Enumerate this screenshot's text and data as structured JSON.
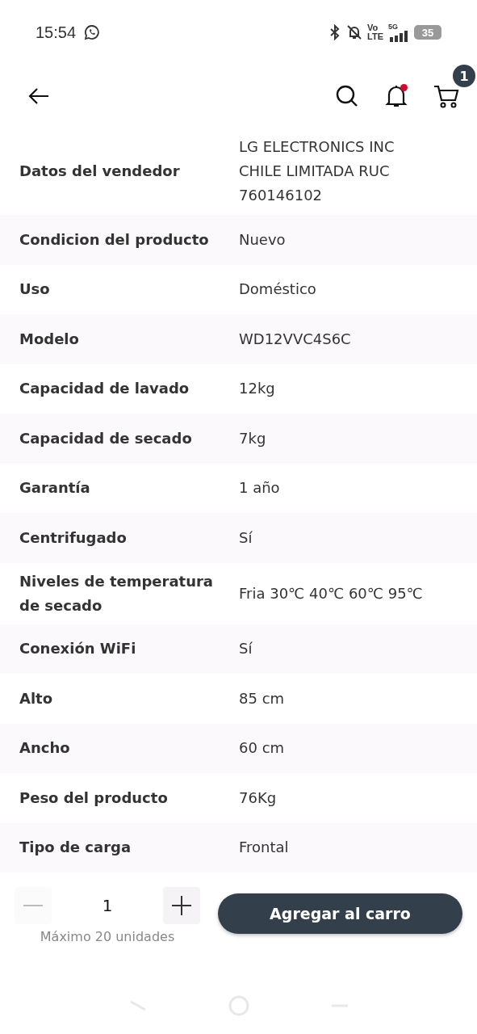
{
  "status_bar": {
    "time": "15:54",
    "volte_top": "Vo",
    "volte_bottom": "LTE",
    "network": "5G",
    "battery": "35"
  },
  "header": {
    "cart_count": "1",
    "notification_dot": true
  },
  "specs": [
    {
      "label": "Datos del vendedor",
      "value": "LG ELECTRONICS INC CHILE LIMITADA RUC 760146102"
    },
    {
      "label": "Condicion del producto",
      "value": "Nuevo"
    },
    {
      "label": "Uso",
      "value": "Doméstico"
    },
    {
      "label": "Modelo",
      "value": "WD12VVC4S6C"
    },
    {
      "label": "Capacidad de lavado",
      "value": "12kg"
    },
    {
      "label": "Capacidad de secado",
      "value": "7kg"
    },
    {
      "label": "Garantía",
      "value": "1 año"
    },
    {
      "label": "Centrifugado",
      "value": "Sí"
    },
    {
      "label": "Niveles de temperatura de secado",
      "value": "Fria 30℃ 40℃ 60℃ 95℃"
    },
    {
      "label": "Conexión WiFi",
      "value": "Sí"
    },
    {
      "label": "Alto",
      "value": "85 cm"
    },
    {
      "label": "Ancho",
      "value": "60 cm"
    },
    {
      "label": "Peso del producto",
      "value": "76Kg"
    },
    {
      "label": "Tipo de carga",
      "value": "Frontal"
    }
  ],
  "footer": {
    "quantity": "1",
    "max_note": "Máximo 20 unidades",
    "add_button": "Agregar al carro"
  }
}
